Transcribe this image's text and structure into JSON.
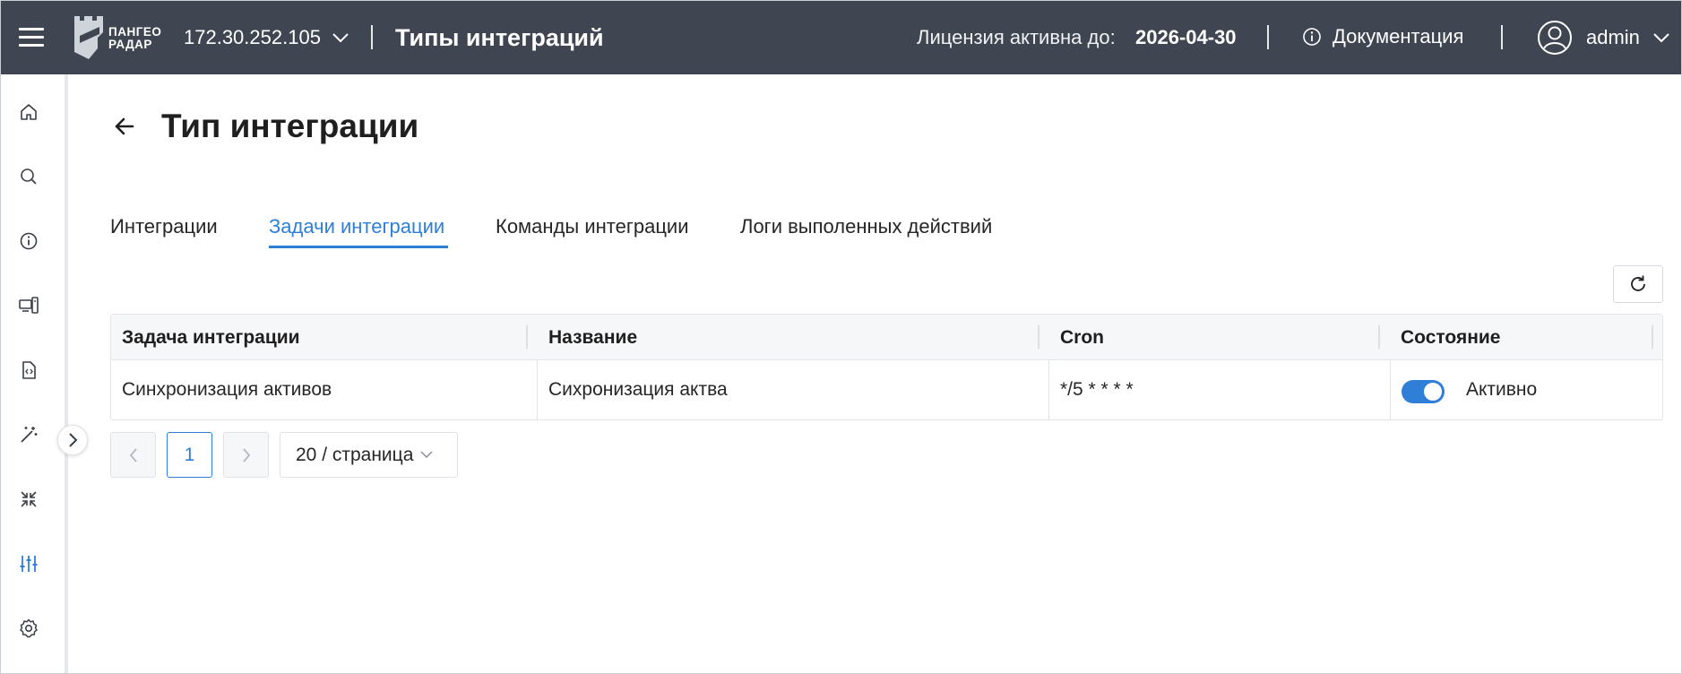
{
  "header": {
    "logo_line1": "ПАНГЕО",
    "logo_line2": "РАДАР",
    "ip": "172.30.252.105",
    "title": "Типы интеграций",
    "license_label": "Лицензия активна до:",
    "license_date": "2026-04-30",
    "docs_label": "Документация",
    "username": "admin"
  },
  "sidebar": {
    "icons": [
      "home-icon",
      "search-icon",
      "info-icon",
      "devices-icon",
      "code-file-icon",
      "magic-wand-icon",
      "collapse-arrows-icon",
      "sliders-icon",
      "gear-icon"
    ],
    "active_icon": "sliders-icon"
  },
  "page": {
    "title": "Тип интеграции"
  },
  "tabs": [
    {
      "label": "Интеграции",
      "active": false
    },
    {
      "label": "Задачи интеграции",
      "active": true
    },
    {
      "label": "Команды интеграции",
      "active": false
    },
    {
      "label": "Логи выполенных действий",
      "active": false
    }
  ],
  "table": {
    "columns": [
      "Задача интеграции",
      "Название",
      "Cron",
      "Состояние"
    ],
    "rows": [
      {
        "task": "Синхронизация активов",
        "name": "Сихронизация актва",
        "cron": "*/5 * * * *",
        "enabled": true,
        "state": "Активно"
      }
    ]
  },
  "pagination": {
    "current_page": "1",
    "page_size": "20 / страница"
  },
  "colors": {
    "header_bg": "#3f4652",
    "accent": "#2f7fd8"
  }
}
